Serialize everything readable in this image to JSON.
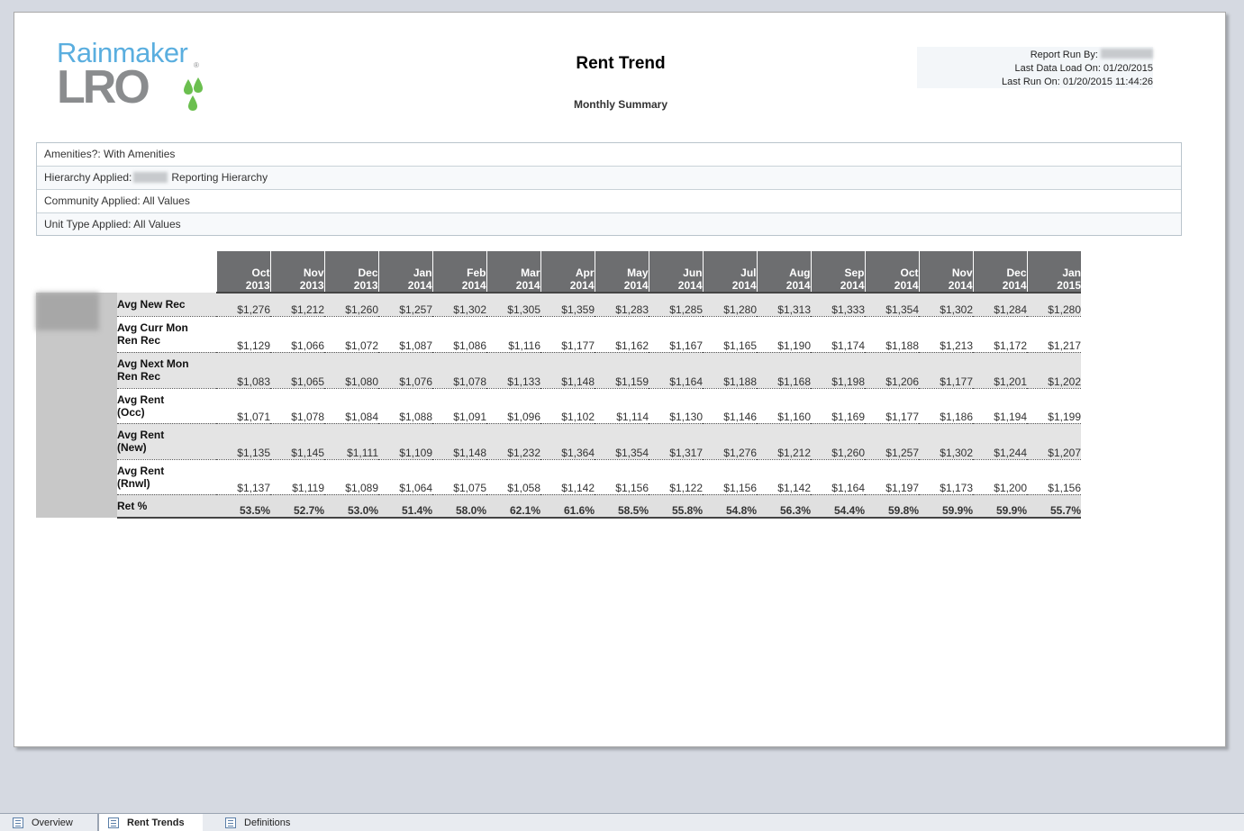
{
  "logo": {
    "line1": "Rainmaker",
    "line2": "LRO",
    "reg": "®"
  },
  "report": {
    "title": "Rent Trend",
    "subtitle": "Monthly Summary"
  },
  "run_info": {
    "run_by_label": "Report Run By: ",
    "last_data_load": "Last Data Load On: 01/20/2015",
    "last_run": "Last Run On: 01/20/2015 11:44:26"
  },
  "filters": {
    "amenities": "Amenities?:  With Amenities",
    "hierarchy_label": "Hierarchy Applied:",
    "hierarchy_value": "Reporting Hierarchy",
    "community": "Community Applied: All Values",
    "unit_type": "Unit Type Applied: All Values"
  },
  "table": {
    "columns": [
      {
        "mon": "Oct",
        "yr": "2013"
      },
      {
        "mon": "Nov",
        "yr": "2013"
      },
      {
        "mon": "Dec",
        "yr": "2013"
      },
      {
        "mon": "Jan",
        "yr": "2014"
      },
      {
        "mon": "Feb",
        "yr": "2014"
      },
      {
        "mon": "Mar",
        "yr": "2014"
      },
      {
        "mon": "Apr",
        "yr": "2014"
      },
      {
        "mon": "May",
        "yr": "2014"
      },
      {
        "mon": "Jun",
        "yr": "2014"
      },
      {
        "mon": "Jul",
        "yr": "2014"
      },
      {
        "mon": "Aug",
        "yr": "2014"
      },
      {
        "mon": "Sep",
        "yr": "2014"
      },
      {
        "mon": "Oct",
        "yr": "2014"
      },
      {
        "mon": "Nov",
        "yr": "2014"
      },
      {
        "mon": "Dec",
        "yr": "2014"
      },
      {
        "mon": "Jan",
        "yr": "2015"
      }
    ],
    "rows": [
      {
        "l1": "Avg New Rec",
        "l2": "",
        "style": "shade",
        "values": [
          "$1,276",
          "$1,212",
          "$1,260",
          "$1,257",
          "$1,302",
          "$1,305",
          "$1,359",
          "$1,283",
          "$1,285",
          "$1,280",
          "$1,313",
          "$1,333",
          "$1,354",
          "$1,302",
          "$1,284",
          "$1,280"
        ]
      },
      {
        "l1": "Avg Curr Mon",
        "l2": "Ren Rec",
        "style": "white",
        "values": [
          "$1,129",
          "$1,066",
          "$1,072",
          "$1,087",
          "$1,086",
          "$1,116",
          "$1,177",
          "$1,162",
          "$1,167",
          "$1,165",
          "$1,190",
          "$1,174",
          "$1,188",
          "$1,213",
          "$1,172",
          "$1,217"
        ]
      },
      {
        "l1": "Avg Next Mon",
        "l2": "Ren Rec",
        "style": "shade",
        "values": [
          "$1,083",
          "$1,065",
          "$1,080",
          "$1,076",
          "$1,078",
          "$1,133",
          "$1,148",
          "$1,159",
          "$1,164",
          "$1,188",
          "$1,168",
          "$1,198",
          "$1,206",
          "$1,177",
          "$1,201",
          "$1,202"
        ]
      },
      {
        "l1": "Avg Rent",
        "l2": "(Occ)",
        "style": "white",
        "values": [
          "$1,071",
          "$1,078",
          "$1,084",
          "$1,088",
          "$1,091",
          "$1,096",
          "$1,102",
          "$1,114",
          "$1,130",
          "$1,146",
          "$1,160",
          "$1,169",
          "$1,177",
          "$1,186",
          "$1,194",
          "$1,199"
        ]
      },
      {
        "l1": "Avg Rent",
        "l2": "(New)",
        "style": "shade",
        "values": [
          "$1,135",
          "$1,145",
          "$1,111",
          "$1,109",
          "$1,148",
          "$1,232",
          "$1,364",
          "$1,354",
          "$1,317",
          "$1,276",
          "$1,212",
          "$1,260",
          "$1,257",
          "$1,302",
          "$1,244",
          "$1,207"
        ]
      },
      {
        "l1": "Avg Rent",
        "l2": "(Rnwl)",
        "style": "white",
        "values": [
          "$1,137",
          "$1,119",
          "$1,089",
          "$1,064",
          "$1,075",
          "$1,058",
          "$1,142",
          "$1,156",
          "$1,122",
          "$1,156",
          "$1,142",
          "$1,164",
          "$1,197",
          "$1,173",
          "$1,200",
          "$1,156"
        ]
      },
      {
        "l1": "Ret %",
        "l2": "",
        "style": "ret",
        "values": [
          "53.5%",
          "52.7%",
          "53.0%",
          "51.4%",
          "58.0%",
          "62.1%",
          "61.6%",
          "58.5%",
          "55.8%",
          "54.8%",
          "56.3%",
          "54.4%",
          "59.8%",
          "59.9%",
          "59.9%",
          "55.7%"
        ]
      }
    ]
  },
  "tabs": [
    {
      "label": "Overview",
      "icon": "report-icon"
    },
    {
      "label": "Rent Trends",
      "icon": "report-icon"
    },
    {
      "label": "Definitions",
      "icon": "document-icon"
    }
  ]
}
